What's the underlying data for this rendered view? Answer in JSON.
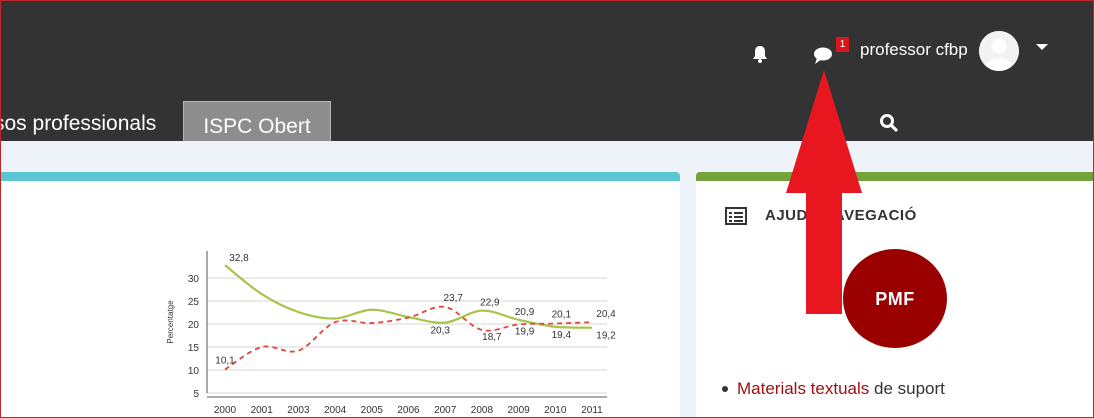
{
  "header": {
    "notification_icon": "bell-icon",
    "messages_icon": "speech-bubble-icon",
    "messages_count": "1",
    "user_name": "professor cfbp",
    "avatar_icon": "user-avatar-icon",
    "menu_icon": "caret-down-icon",
    "search_icon": "search-icon"
  },
  "nav": {
    "tabs": [
      {
        "label": "sos professionals"
      },
      {
        "label": "ISPC Obert"
      }
    ]
  },
  "block": {
    "title": "AJUDA NAVEGACIÓ",
    "title_visible": "AJUD",
    "title_visible_end": "AVEGACIÓ",
    "icon": "list-icon",
    "logo_text": "PMF",
    "list": [
      {
        "link": "Materials textuals",
        "rest": " de suport"
      }
    ]
  },
  "colors": {
    "topbar": "#333333",
    "card_left_accent": "#5bc5d1",
    "card_right_accent": "#74a33c",
    "logo": "#9a0000",
    "link": "#9b1010",
    "arrow": "#e8161f",
    "series_solid": "#a8c44a",
    "series_dashed": "#e0463c"
  },
  "chart_data": {
    "type": "line",
    "ylabel": "Percentatge",
    "ylim": [
      5,
      35
    ],
    "yticks": [
      5,
      10,
      15,
      20,
      25,
      30
    ],
    "categories": [
      "2000",
      "2001",
      "2003",
      "2004",
      "2005",
      "2006",
      "2007",
      "2008",
      "2009",
      "2010",
      "2011"
    ],
    "series": [
      {
        "style": "solid",
        "values": [
          32.8,
          26.5,
          22.6,
          21.2,
          23.1,
          21.5,
          20.3,
          22.9,
          20.9,
          19.4,
          19.2
        ],
        "labels": {
          "0": "32,8",
          "6": "20,3",
          "7": "22,9",
          "8": "20,9",
          "9": "19,4",
          "10": "19,2"
        }
      },
      {
        "style": "dashed",
        "values": [
          10.1,
          15.0,
          14.2,
          20.4,
          20.2,
          21.4,
          23.7,
          18.7,
          19.9,
          20.1,
          20.4
        ],
        "labels": {
          "0": "10,1",
          "6": "23,7",
          "7": "18,7",
          "8": "19,9",
          "9": "20,1",
          "10": "20,4"
        }
      }
    ]
  }
}
